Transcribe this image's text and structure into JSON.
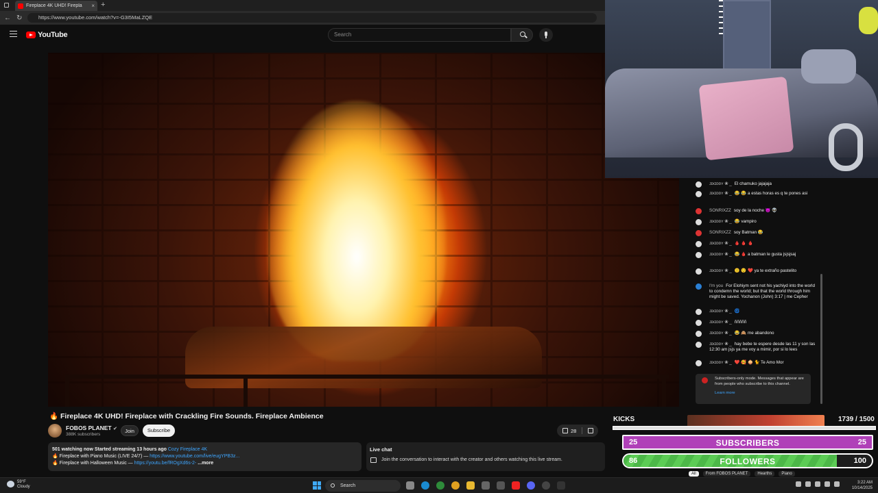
{
  "browser": {
    "tab_title": "Fireplace 4K UHD! Firepla",
    "url": "https://www.youtube.com/watch?v=-G3I5MaLZQE"
  },
  "youtube": {
    "brand": "YouTube",
    "search_placeholder": "Search"
  },
  "video": {
    "title": "Fireplace 4K UHD! Fireplace with Crackling Fire Sounds. Fireplace Ambience",
    "channel": "FOBOS PLANET",
    "subscribers": "388K subscribers",
    "join_label": "Join",
    "subscribe_label": "Subscribe",
    "likes": "28"
  },
  "description": {
    "line1": "501 watching now  Started streaming 13 hours ago",
    "line1_tag": "Cozy Fireplace 4K",
    "line2_text": "Fireplace with Piano Music (LIVE 24/7) — ",
    "line2_link": "https://www.youtube.com/live/eugYPB3z...",
    "line3_text": "Fireplace with Halloween Music — ",
    "line3_link": "https://youtu.be/fROgXd6s-2-",
    "more": "...more"
  },
  "livechat": {
    "title": "Live chat",
    "text": "Join the conversation to interact with the creator and others watching this live stream."
  },
  "stream_chat": [
    {
      "name": "ᴊɪᴋɪᴅᴅʏ ❀ _",
      "msg": "El chamuko jajajaja",
      "av": "white"
    },
    {
      "name": "ᴊɪᴋɪᴅᴅʏ ❀ _",
      "msg": "😂 😂 a estas horas es q te pones asi",
      "av": "white"
    },
    {
      "name": "SONRIXZZ",
      "msg": "soy de la noche 😈 👽",
      "av": "red"
    },
    {
      "name": "ᴊɪᴋɪᴅᴅʏ ❀ _",
      "msg": "😂 vampiro",
      "av": "white"
    },
    {
      "name": "SONRIXZZ",
      "msg": "soy Batman 😂",
      "av": "red"
    },
    {
      "name": "ᴊɪᴋɪᴅᴅʏ ❀ _",
      "msg": "🩸 🩸 🩸",
      "av": "white"
    },
    {
      "name": "ᴊɪᴋɪᴅᴅʏ ❀ _",
      "msg": "😂 🩸 a batman le gusta jsjsjsaj",
      "av": "white"
    },
    {
      "name": "ᴊɪᴋɪᴅᴅʏ ❀ _",
      "msg": "🙁 😌 ❤️ ya te extraño pastelito",
      "av": "white"
    },
    {
      "name": "I'm you",
      "msg": "For Elohiym sent not his yachiyd into the world to condemn the world; but that the world through him might be saved. Yochanon (John) 3:17 | me Cepher",
      "av": "blue"
    },
    {
      "name": "ᴊɪᴋɪᴅᴅʏ ❀ _",
      "msg": "🌀",
      "av": "white"
    },
    {
      "name": "ᴊɪᴋɪᴅᴅʏ ❀ _",
      "msg": "ñññññ",
      "av": "white"
    },
    {
      "name": "ᴊɪᴋɪᴅᴅʏ ❀ _",
      "msg": "😂 🙈 me abandono",
      "av": "white"
    },
    {
      "name": "ᴊɪᴋɪᴅᴅʏ ❀ _",
      "msg": "hay bebe te espere desde las 11 y son las 12:30 am jsjs ya me voy a mimir, por si lo lees",
      "av": "white"
    },
    {
      "name": "ᴊɪᴋɪᴅᴅʏ ❀ _",
      "msg": "❤️ 🥰 🧅 🐈 Te Amo Mor",
      "av": "white"
    }
  ],
  "sub_only": {
    "text": "Subscribers-only mode. Messages that appear are from people who subscribe to this channel.",
    "learn_more": "Learn more"
  },
  "goals": {
    "kicks_label": "KICKS",
    "kicks_count": "1739  / 1500",
    "kicks_progress": 1.0,
    "subs_left": "25",
    "subs_label": "SUBSCRIBERS",
    "subs_right": "25",
    "subs_progress": 1.0,
    "foll_left": "86",
    "foll_label": "FOLLOWERS",
    "foll_right": "100",
    "foll_progress": 0.86
  },
  "chips": [
    "All",
    "From FOBOS PLANET",
    "Hearths",
    "Piano"
  ],
  "taskbar": {
    "temp": "59°F",
    "weather": "Cloudy",
    "search": "Search",
    "time": "3:22 AM",
    "date": "10/14/2025"
  },
  "colors": {
    "yt_red": "#ff0000",
    "subs_purple": "#b040b8",
    "follow_green": "#4cb848",
    "link_blue": "#3ea6ff"
  }
}
